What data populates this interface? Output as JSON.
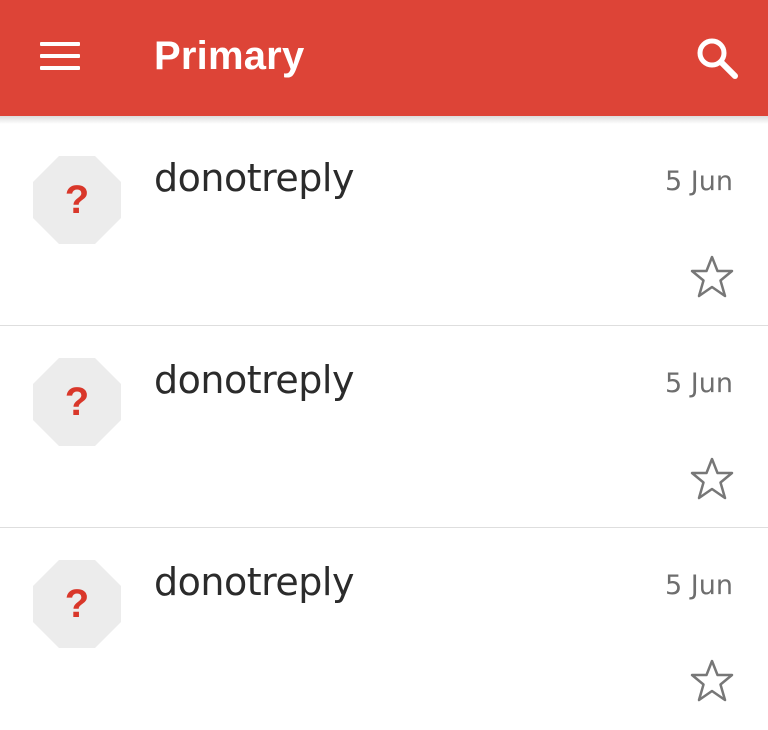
{
  "header": {
    "title": "Primary",
    "background_color": "#dd4437",
    "menu_icon": "menu-icon",
    "search_icon": "search-icon"
  },
  "messages": [
    {
      "sender": "donotreply",
      "date": "5 Jun",
      "avatar_glyph": "?",
      "starred": false
    },
    {
      "sender": "donotreply",
      "date": "5 Jun",
      "avatar_glyph": "?",
      "starred": false
    },
    {
      "sender": "donotreply",
      "date": "5 Jun",
      "avatar_glyph": "?",
      "starred": false
    }
  ]
}
